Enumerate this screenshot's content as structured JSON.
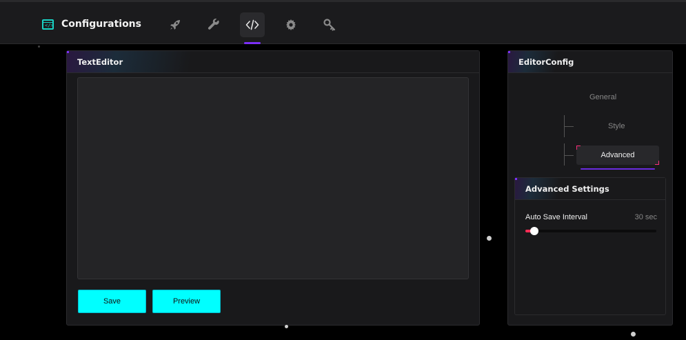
{
  "app": {
    "title": "Configurations",
    "brand_icon_glyph": "</>"
  },
  "nav": {
    "items": [
      {
        "name": "rocket-icon",
        "active": false
      },
      {
        "name": "wrench-icon",
        "active": false
      },
      {
        "name": "code-icon",
        "active": true
      },
      {
        "name": "gear-icon",
        "active": false
      },
      {
        "name": "key-icon",
        "active": false
      }
    ],
    "accent": "#7b2ff7"
  },
  "text_editor": {
    "title": "TextEditor",
    "content": "",
    "save_label": "Save",
    "preview_label": "Preview"
  },
  "editor_config": {
    "title": "EditorConfig",
    "tree": {
      "root": "General",
      "children": [
        "Style",
        "Advanced"
      ],
      "selected": "Advanced"
    }
  },
  "advanced_settings": {
    "title": "Advanced Settings",
    "auto_save": {
      "label": "Auto Save Interval",
      "value_text": "30 sec",
      "fraction": 0.07
    }
  },
  "colors": {
    "button": "#00ffff",
    "slider_fill": "#ff2d55",
    "brand": "#19d3c5"
  }
}
